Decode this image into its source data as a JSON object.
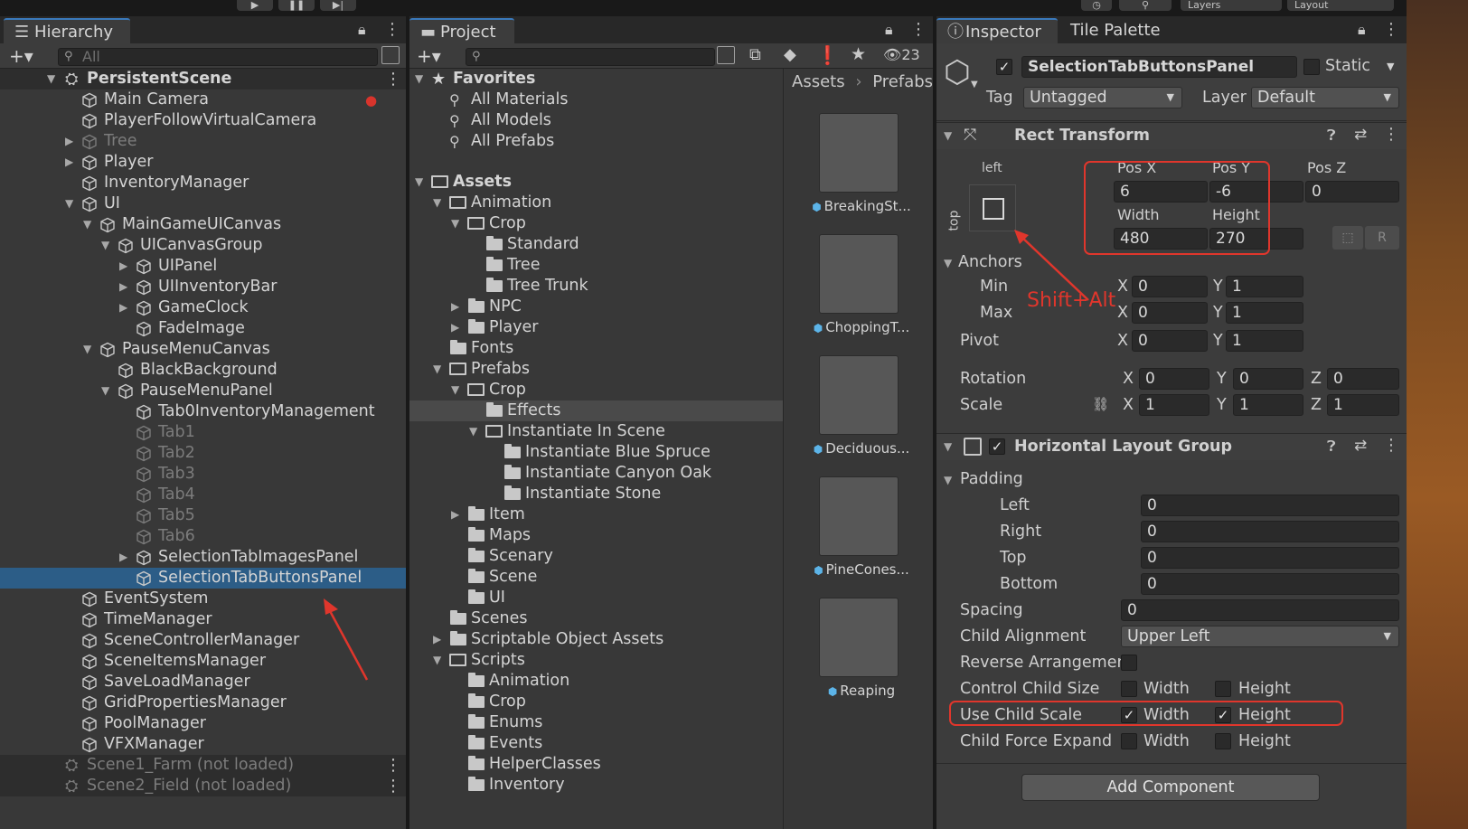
{
  "toolbar_top": {
    "play_icon": "play-icon",
    "pause_icon": "pause-icon",
    "step_icon": "step-icon",
    "layers_label": "Layers",
    "layout_label": "Layout"
  },
  "hierarchy": {
    "tab_label": "Hierarchy",
    "search_placeholder": "All",
    "root": "PersistentScene",
    "items": [
      {
        "label": "Main Camera"
      },
      {
        "label": "PlayerFollowVirtualCamera"
      },
      {
        "label": "Tree"
      },
      {
        "label": "Player"
      },
      {
        "label": "InventoryManager"
      },
      {
        "label": "UI"
      },
      {
        "label": "MainGameUICanvas"
      },
      {
        "label": "UICanvasGroup"
      },
      {
        "label": "UIPanel"
      },
      {
        "label": "UIInventoryBar"
      },
      {
        "label": "GameClock"
      },
      {
        "label": "FadeImage"
      },
      {
        "label": "PauseMenuCanvas"
      },
      {
        "label": "BlackBackground"
      },
      {
        "label": "PauseMenuPanel"
      },
      {
        "label": "Tab0InventoryManagement"
      },
      {
        "label": "Tab1"
      },
      {
        "label": "Tab2"
      },
      {
        "label": "Tab3"
      },
      {
        "label": "Tab4"
      },
      {
        "label": "Tab5"
      },
      {
        "label": "Tab6"
      },
      {
        "label": "SelectionTabImagesPanel"
      },
      {
        "label": "SelectionTabButtonsPanel"
      },
      {
        "label": "EventSystem"
      },
      {
        "label": "TimeManager"
      },
      {
        "label": "SceneControllerManager"
      },
      {
        "label": "SceneItemsManager"
      },
      {
        "label": "SaveLoadManager"
      },
      {
        "label": "GridPropertiesManager"
      },
      {
        "label": "PoolManager"
      },
      {
        "label": "VFXManager"
      }
    ],
    "scenes": [
      {
        "label": "Scene1_Farm (not loaded)"
      },
      {
        "label": "Scene2_Field (not loaded)"
      }
    ]
  },
  "project": {
    "tab_label": "Project",
    "hidden_count": "23",
    "favorites_label": "Favorites",
    "favorites": [
      "All Materials",
      "All Models",
      "All Prefabs"
    ],
    "assets_label": "Assets",
    "tree": [
      "Animation",
      "Crop",
      "Standard",
      "Tree",
      "Tree Trunk",
      "NPC",
      "Player",
      "Fonts",
      "Prefabs",
      "Crop",
      "Effects",
      "Instantiate In Scene",
      "Instantiate Blue Spruce",
      "Instantiate Canyon Oak",
      "Instantiate Stone",
      "Item",
      "Maps",
      "Scenary",
      "Scene",
      "UI",
      "Scenes",
      "Scriptable Object Assets",
      "Scripts",
      "Animation",
      "Crop",
      "Enums",
      "Events",
      "HelperClasses",
      "Inventory"
    ],
    "breadcrumb": [
      "Assets",
      "Prefabs"
    ],
    "thumbnails": [
      "BreakingSt...",
      "ChoppingT...",
      "Deciduous...",
      "PineCones...",
      "Reaping"
    ]
  },
  "inspector": {
    "tab_label": "Inspector",
    "tab2_label": "Tile Palette",
    "object_name": "SelectionTabButtonsPanel",
    "static_label": "Static",
    "tag_label": "Tag",
    "tag_value": "Untagged",
    "layer_label": "Layer",
    "layer_value": "Default",
    "rect": {
      "title": "Rect Transform",
      "anchor_h": "left",
      "anchor_v": "top",
      "pos_x_label": "Pos X",
      "pos_y_label": "Pos Y",
      "pos_z_label": "Pos Z",
      "pos_x": "6",
      "pos_y": "-6",
      "pos_z": "0",
      "width_label": "Width",
      "height_label": "Height",
      "width": "480",
      "height": "270",
      "r_btn": "R",
      "anchors_label": "Anchors",
      "min_label": "Min",
      "max_label": "Max",
      "min_x": "0",
      "min_y": "1",
      "max_x": "0",
      "max_y": "1",
      "pivot_label": "Pivot",
      "pivot_x": "0",
      "pivot_y": "1",
      "rotation_label": "Rotation",
      "rot_x": "0",
      "rot_y": "0",
      "rot_z": "0",
      "scale_label": "Scale",
      "scale_x": "1",
      "scale_y": "1",
      "scale_z": "1",
      "x": "X",
      "y": "Y",
      "z": "Z"
    },
    "annotation": "Shift+Alt",
    "hlg": {
      "title": "Horizontal Layout Group",
      "padding_label": "Padding",
      "left_label": "Left",
      "left": "0",
      "right_label": "Right",
      "right": "0",
      "top_label": "Top",
      "top": "0",
      "bottom_label": "Bottom",
      "bottom": "0",
      "spacing_label": "Spacing",
      "spacing": "0",
      "child_alignment_label": "Child Alignment",
      "child_alignment": "Upper Left",
      "reverse_label": "Reverse Arrangemen",
      "control_label": "Control Child Size",
      "use_scale_label": "Use Child Scale",
      "force_expand_label": "Child Force Expand",
      "width_label": "Width",
      "height_label": "Height",
      "check": "✓"
    },
    "add_component": "Add Component"
  }
}
